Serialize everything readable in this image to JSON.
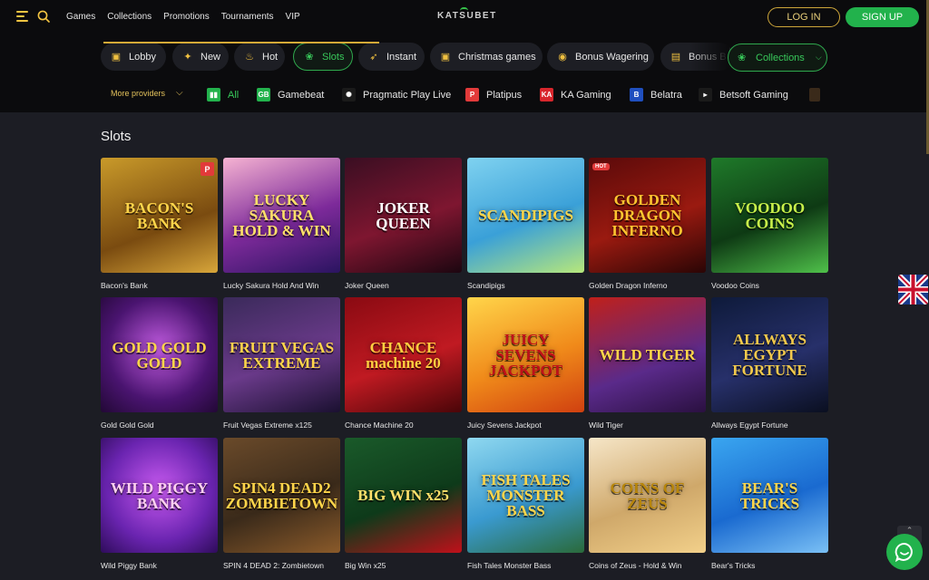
{
  "header": {
    "nav": [
      "Games",
      "Collections",
      "Promotions",
      "Tournaments",
      "VIP"
    ],
    "logo_text": "KATSUBET",
    "login_label": "LOG IN",
    "signup_label": "SIGN UP"
  },
  "tabs": [
    {
      "label": "Lobby",
      "icon": "lobby-icon",
      "glyph": "▣"
    },
    {
      "label": "New",
      "icon": "new-icon",
      "glyph": "✦"
    },
    {
      "label": "Hot",
      "icon": "fire-icon",
      "glyph": "♨"
    },
    {
      "label": "Slots",
      "icon": "cherry-icon",
      "glyph": "❀",
      "active": true
    },
    {
      "label": "Instant",
      "icon": "rocket-icon",
      "glyph": "➶"
    },
    {
      "label": "Christmas games",
      "icon": "gift-icon",
      "glyph": "▣"
    },
    {
      "label": "Bonus Wagering",
      "icon": "coin-icon",
      "glyph": "◉"
    },
    {
      "label": "Bonus B",
      "icon": "gift-icon",
      "glyph": "▤"
    }
  ],
  "collections_label": "Collections",
  "providers": {
    "more_label": "More providers",
    "items": [
      {
        "label": "All",
        "icon": "all-providers-icon",
        "color": "#22b24c",
        "mark": "▮▮"
      },
      {
        "label": "Gamebeat",
        "icon": "gamebeat-icon",
        "color": "#22b24c",
        "mark": "GB"
      },
      {
        "label": "Pragmatic Play Live",
        "icon": "pragmatic-icon",
        "color": "#1a1a1a",
        "mark": "✺"
      },
      {
        "label": "Platipus",
        "icon": "platipus-icon",
        "color": "#e23a3a",
        "mark": "P"
      },
      {
        "label": "KA Gaming",
        "icon": "ka-gaming-icon",
        "color": "#d8262c",
        "mark": "KA"
      },
      {
        "label": "Belatra",
        "icon": "belatra-icon",
        "color": "#1f4fbf",
        "mark": "B"
      },
      {
        "label": "Betsoft Gaming",
        "icon": "betsoft-icon",
        "color": "#1a1a1a",
        "mark": "▸"
      }
    ]
  },
  "section_title": "Slots",
  "games": [
    {
      "name": "Bacon's Bank",
      "art": "BACON'S BANK",
      "bg": "linear-gradient(160deg,#c99a2a,#7a4b10 60%,#d8a63a)",
      "fg": "#ffd54a",
      "badge": "P"
    },
    {
      "name": "Lucky Sakura Hold And Win",
      "art": "LUCKY SAKURA HOLD & WIN",
      "bg": "linear-gradient(160deg,#f6b3d2,#7d2a9a 55%,#2a1460)",
      "fg": "#ffe06a"
    },
    {
      "name": "Joker Queen",
      "art": "JOKER QUEEN",
      "bg": "linear-gradient(160deg,#3a0e22,#7e1630 55%,#1c0610)",
      "fg": "#ffffff"
    },
    {
      "name": "Scandipigs",
      "art": "SCANDIPIGS",
      "bg": "linear-gradient(160deg,#7fd2f0,#3aa0d8 55%,#b7e77a)",
      "fg": "#ffd54a"
    },
    {
      "name": "Golden Dragon Inferno",
      "art": "GOLDEN DRAGON INFERNO",
      "bg": "linear-gradient(160deg,#5a0a0a,#9a1a10 55%,#2a0505)",
      "fg": "#ffc530",
      "hot": "HOT"
    },
    {
      "name": "Voodoo Coins",
      "art": "VOODOO COINS",
      "bg": "linear-gradient(160deg,#1f7a2a,#0e3a14 55%,#4fc14a)",
      "fg": "#c8f04a"
    },
    {
      "name": "Gold Gold Gold",
      "art": "GOLD GOLD GOLD",
      "bg": "radial-gradient(circle at 50% 45%,#c15be0,#4a1470 60%,#220835)",
      "fg": "#ffd54a"
    },
    {
      "name": "Fruit Vegas Extreme x125",
      "art": "FRUIT VEGAS EXTREME",
      "bg": "linear-gradient(160deg,#3a2a5a,#6a3a8a 55%,#1a1030)",
      "fg": "#ffd54a"
    },
    {
      "name": "Chance Machine 20",
      "art": "CHANCE machine 20",
      "bg": "linear-gradient(160deg,#8a0a12,#c01a22 55%,#4a0508)",
      "fg": "#ffcf40"
    },
    {
      "name": "Juicy Sevens Jackpot",
      "art": "JUICY SEVENS JACKPOT",
      "bg": "linear-gradient(160deg,#ffd54a,#f08a1a 55%,#d04010)",
      "fg": "#c0101a"
    },
    {
      "name": "Wild Tiger",
      "art": "WILD TIGER",
      "bg": "linear-gradient(160deg,#c0201a,#5a2a8a 60%,#2a1040)",
      "fg": "#ffd54a"
    },
    {
      "name": "Allways Egypt Fortune",
      "art": "ALLWAYS EGYPT FORTUNE",
      "bg": "linear-gradient(160deg,#0e1a3a,#27306a 55%,#0a0f20)",
      "fg": "#f2c94c"
    },
    {
      "name": "Wild Piggy Bank",
      "art": "WILD PIGGY BANK",
      "bg": "radial-gradient(circle at 50% 45%,#c85af0,#6a24b0 60%,#2e0c5a)",
      "fg": "#ffd0f0"
    },
    {
      "name": "SPIN 4 DEAD 2: Zombietown",
      "art": "SPIN4 DEAD2 ZOMBIETOWN",
      "bg": "linear-gradient(160deg,#6a4a2a,#3a2a1a 55%,#8a5a2a)",
      "fg": "#ffd54a"
    },
    {
      "name": "Big Win x25",
      "art": "BIG WIN x25",
      "bg": "linear-gradient(160deg,#1a5a2a,#0e3a1a 55%,#c0101a)",
      "fg": "#ffe06a"
    },
    {
      "name": "Fish Tales Monster Bass",
      "art": "FISH TALES MONSTER BASS",
      "bg": "linear-gradient(160deg,#8fd8f0,#3a9ad0 55%,#2a6a3a)",
      "fg": "#ffd54a"
    },
    {
      "name": "Coins of Zeus - Hold & Win",
      "art": "COINS OF ZEUS",
      "bg": "linear-gradient(160deg,#f6e6c8,#cfa86a 55%,#f2d08a)",
      "fg": "#b8860b"
    },
    {
      "name": "Bear's Tricks",
      "art": "BEAR'S TRICKS",
      "bg": "linear-gradient(160deg,#3aa6f0,#1a6ad0 55%,#7ac0f5)",
      "fg": "#ffd54a"
    }
  ],
  "colors": {
    "accent_green": "#22b24c",
    "accent_gold": "#d4a937",
    "background": "#1c1d24",
    "header": "#0b0b0d"
  }
}
